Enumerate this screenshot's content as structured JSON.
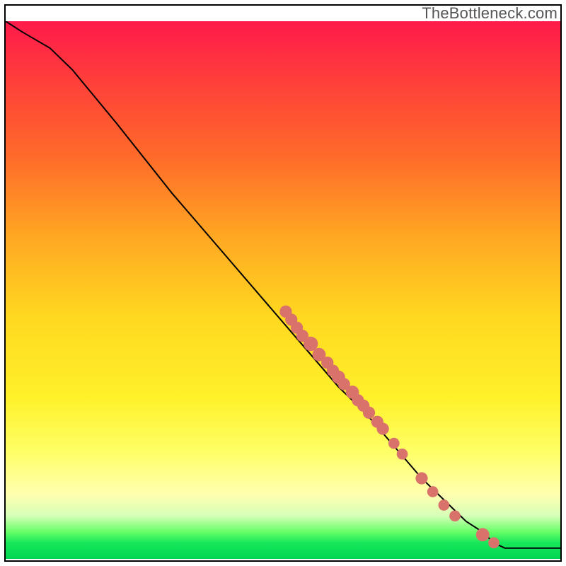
{
  "watermark": "TheBottleneck.com",
  "colors": {
    "dot": "#d9726b",
    "curve": "#000"
  },
  "chart_data": {
    "type": "line",
    "title": "",
    "xlabel": "",
    "ylabel": "",
    "xlim": [
      0,
      100
    ],
    "ylim": [
      0,
      100
    ],
    "series": [
      {
        "name": "curve",
        "x": [
          0,
          3,
          8,
          12,
          20,
          30,
          40,
          50,
          55,
          60,
          65,
          70,
          75,
          80,
          83,
          86,
          88,
          90,
          92,
          100
        ],
        "y": [
          100,
          98,
          95,
          91,
          81,
          68,
          56,
          44,
          38,
          32,
          27,
          21,
          15,
          10,
          7,
          5,
          3,
          2,
          2,
          2
        ]
      }
    ],
    "scatter": {
      "name": "dots",
      "points": [
        {
          "x": 50.5,
          "y": 46.0,
          "r": 1.1
        },
        {
          "x": 51.5,
          "y": 44.5,
          "r": 1.1
        },
        {
          "x": 52.5,
          "y": 43.0,
          "r": 1.1
        },
        {
          "x": 53.5,
          "y": 41.5,
          "r": 1.1
        },
        {
          "x": 55.0,
          "y": 40.0,
          "r": 1.3
        },
        {
          "x": 56.5,
          "y": 38.0,
          "r": 1.2
        },
        {
          "x": 58.0,
          "y": 36.5,
          "r": 1.1
        },
        {
          "x": 59.0,
          "y": 35.0,
          "r": 1.1
        },
        {
          "x": 60.0,
          "y": 33.8,
          "r": 1.2
        },
        {
          "x": 61.0,
          "y": 32.5,
          "r": 1.1
        },
        {
          "x": 62.5,
          "y": 31.0,
          "r": 1.2
        },
        {
          "x": 63.5,
          "y": 29.5,
          "r": 1.1
        },
        {
          "x": 64.5,
          "y": 28.5,
          "r": 1.1
        },
        {
          "x": 65.5,
          "y": 27.2,
          "r": 1.1
        },
        {
          "x": 67.0,
          "y": 25.5,
          "r": 1.1
        },
        {
          "x": 68.0,
          "y": 24.2,
          "r": 1.1
        },
        {
          "x": 70.0,
          "y": 21.5,
          "r": 1.0
        },
        {
          "x": 71.5,
          "y": 19.5,
          "r": 1.0
        },
        {
          "x": 75.0,
          "y": 15.0,
          "r": 1.1
        },
        {
          "x": 77.0,
          "y": 12.5,
          "r": 1.0
        },
        {
          "x": 79.0,
          "y": 10.0,
          "r": 1.0
        },
        {
          "x": 81.0,
          "y": 8.0,
          "r": 1.0
        },
        {
          "x": 86.0,
          "y": 4.5,
          "r": 1.2
        },
        {
          "x": 88.0,
          "y": 3.0,
          "r": 1.0
        }
      ]
    }
  }
}
